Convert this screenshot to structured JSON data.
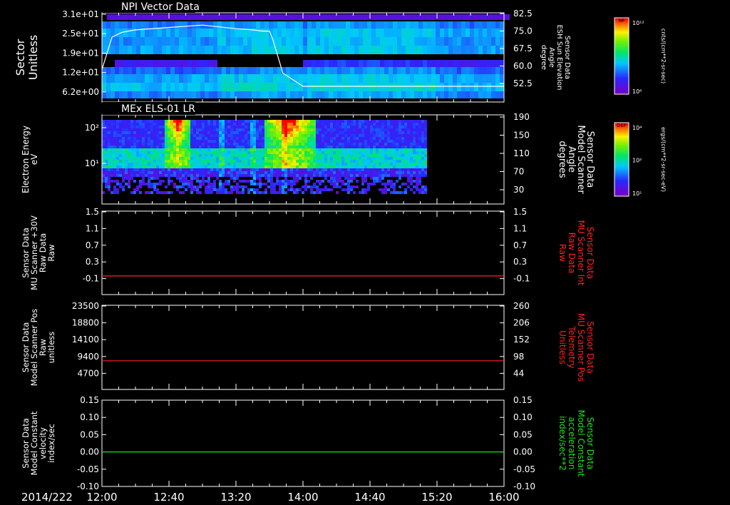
{
  "date_label": "2014/222",
  "x_axis": {
    "ticks": [
      "12:00",
      "12:40",
      "13:20",
      "14:00",
      "14:40",
      "15:20",
      "16:00"
    ]
  },
  "panels": [
    {
      "title": "NPI Vector Data",
      "left_label": [
        "Sector",
        "Unitless"
      ],
      "left_ticks": [
        "3.1e+01",
        "2.5e+01",
        "1.9e+01",
        "1.2e+01",
        "6.2e+00"
      ],
      "right_label": [
        "Sensor Data",
        "ESH Sun Elevation",
        "Angle",
        "degree"
      ],
      "right_ticks": [
        "82.5",
        "75.0",
        "67.5",
        "60.0",
        "52.5"
      ],
      "colorbar": {
        "top_label": "NF",
        "tick_top": "10¹²",
        "tick_bottom": "10⁶",
        "units": "cnts/(cm**2-sr-sec)"
      }
    },
    {
      "title": "MEx ELS-01 LR",
      "left_label": [
        "Electron Energy",
        "eV"
      ],
      "left_ticks": [
        "10²",
        "10¹"
      ],
      "right_label": [
        "Sensor Data",
        "Model Scanner",
        "Angle",
        "degrees"
      ],
      "right_ticks": [
        "190",
        "150",
        "110",
        "70",
        "30"
      ],
      "colorbar": {
        "top_label": "DEF",
        "tick_top": "10⁴",
        "tick_mid": "10²",
        "tick_bottom": "10¹",
        "units": "ergs/(cm**2-sr-sec-eV)"
      }
    },
    {
      "left_label": [
        "Sensor Data",
        "MU Scanner +30V",
        "Raw Data",
        "Raw"
      ],
      "left_ticks": [
        "1.5",
        "1.1",
        "0.7",
        "0.3",
        "-0.1"
      ],
      "right_label": [
        "Sensor Data",
        "MU Scanner Int",
        "Raw Data",
        "Raw"
      ],
      "right_ticks": [
        "1.5",
        "1.1",
        "0.7",
        "0.3",
        "-0.1"
      ],
      "right_color": "#ff2020"
    },
    {
      "left_label": [
        "Sensor Data",
        "Model Scanner Pos",
        "Raw",
        "unitless"
      ],
      "left_ticks": [
        "23500",
        "18800",
        "14100",
        "9400",
        "4700"
      ],
      "right_label": [
        "Sensor Data",
        "MU Scanner Pos",
        "Telemetry",
        "Unitless"
      ],
      "right_ticks": [
        "260",
        "206",
        "152",
        "98",
        "44"
      ],
      "right_color": "#ff2020"
    },
    {
      "left_label": [
        "Sensor Data",
        "Model Constant",
        "velocity",
        "index/sec"
      ],
      "left_ticks": [
        "0.15",
        "0.10",
        "0.05",
        "0.00",
        "-0.05",
        "-0.10"
      ],
      "right_label": [
        "Sensor Data",
        "Model Constant",
        "acceleration",
        "index/sec**2"
      ],
      "right_ticks": [
        "0.15",
        "0.10",
        "0.05",
        "0.00",
        "-0.05",
        "-0.10"
      ],
      "right_color": "#20e020"
    }
  ],
  "chart_data": {
    "type": "heatmap",
    "x_range": [
      "12:00",
      "16:00"
    ],
    "series": [
      {
        "name": "ESH Sun Elevation",
        "panel": 0,
        "color": "#ffffff",
        "x": [
          "12:00",
          "12:06",
          "12:12",
          "12:20",
          "12:40",
          "13:00",
          "13:20",
          "13:30",
          "13:36",
          "13:40",
          "13:42",
          "13:48",
          "14:00",
          "14:20",
          "15:00",
          "16:00"
        ],
        "y": [
          59.5,
          73,
          75,
          76,
          77,
          78,
          76.5,
          76,
          75.5,
          75.5,
          72,
          58,
          52.5,
          52.5,
          52.5,
          52.5
        ]
      },
      {
        "name": "MU Scanner Int",
        "panel": 2,
        "color": "#ff2020",
        "x": [
          "12:00",
          "16:00"
        ],
        "y": [
          0.0,
          0.0
        ]
      },
      {
        "name": "MU Scanner Pos",
        "panel": 3,
        "color": "#ff2020",
        "x": [
          "12:00",
          "16:00"
        ],
        "y": [
          85,
          85
        ]
      },
      {
        "name": "Model Constant acceleration",
        "panel": 4,
        "color": "#20e020",
        "x": [
          "12:00",
          "16:00"
        ],
        "y": [
          0.0,
          0.0
        ]
      }
    ],
    "electron_heatmap": {
      "data_end": "15:13",
      "hot_intervals": [
        [
          "12:37",
          "12:52"
        ],
        [
          "13:36",
          "14:07"
        ]
      ],
      "spike_times": [
        "13:10",
        "13:29",
        "13:48"
      ]
    }
  }
}
